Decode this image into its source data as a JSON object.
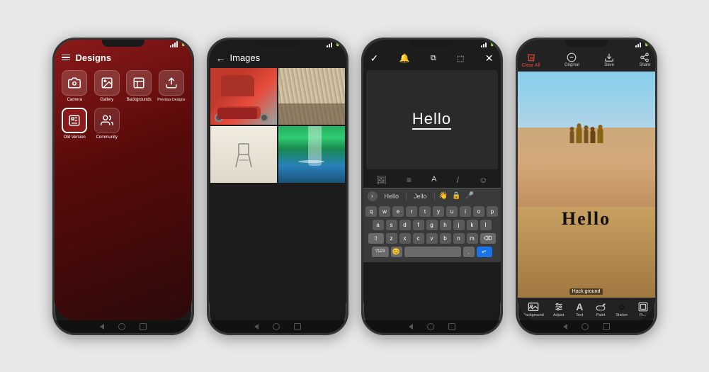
{
  "phones": [
    {
      "id": "phone1",
      "title": "Designs",
      "header": {
        "menu_icon": "☰",
        "title": "Designs"
      },
      "grid_items": [
        {
          "label": "Camera",
          "icon": "camera"
        },
        {
          "label": "Gallery",
          "icon": "gallery"
        },
        {
          "label": "Backgrounds",
          "icon": "backgrounds"
        },
        {
          "label": "Previous Designs",
          "icon": "previous"
        },
        {
          "label": "Old Version",
          "icon": "old-version"
        },
        {
          "label": "Community",
          "icon": "community"
        }
      ]
    },
    {
      "id": "phone2",
      "title": "Images",
      "header": {
        "back_icon": "←",
        "title": "Images"
      }
    },
    {
      "id": "phone3",
      "canvas_text": "Hello",
      "keyboard": {
        "suggestions": [
          "Hello",
          "Jello"
        ],
        "rows": [
          [
            "q",
            "w",
            "e",
            "r",
            "t",
            "y",
            "u",
            "i",
            "o",
            "p"
          ],
          [
            "a",
            "s",
            "d",
            "f",
            "g",
            "h",
            "j",
            "k",
            "l"
          ],
          [
            "⇧",
            "z",
            "x",
            "c",
            "v",
            "b",
            "n",
            "m",
            "⌫"
          ],
          [
            "?123",
            "😊",
            "",
            "",
            ",",
            "↵"
          ]
        ]
      }
    },
    {
      "id": "phone4",
      "toolbar": {
        "clear_all": "Clear All",
        "original": "Original",
        "save": "Save",
        "share": "Share"
      },
      "canvas_text": "Hello",
      "bottom_tools": [
        {
          "label": "Background",
          "icon": "background"
        },
        {
          "label": "Adjust",
          "icon": "adjust"
        },
        {
          "label": "Text",
          "icon": "text"
        },
        {
          "label": "Paint",
          "icon": "paint"
        },
        {
          "label": "Sticker",
          "icon": "sticker"
        },
        {
          "label": "Fr...",
          "icon": "frame"
        }
      ],
      "hack_ground": "Hack ground"
    }
  ]
}
